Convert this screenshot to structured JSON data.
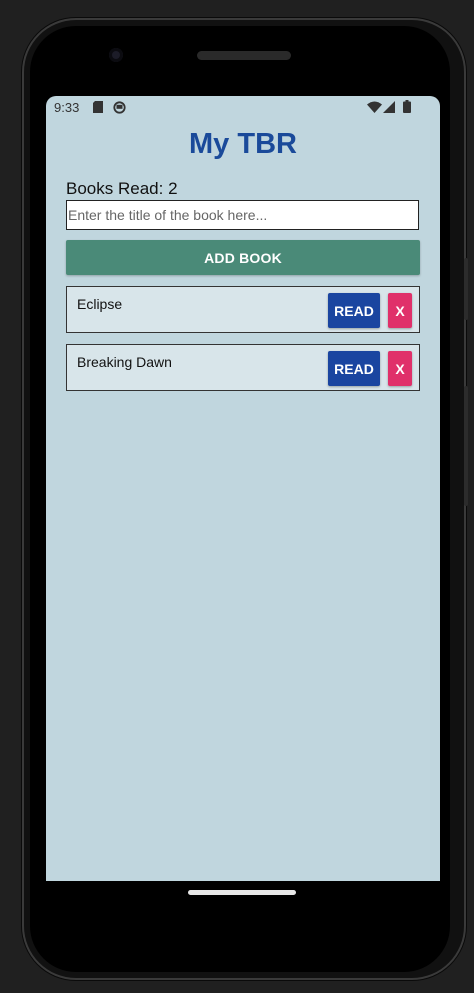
{
  "status_bar": {
    "time": "9:33",
    "icons": [
      "sd-card-icon",
      "notification-icon",
      "wifi-icon",
      "signal-icon",
      "battery-icon"
    ]
  },
  "app": {
    "title": "My TBR",
    "books_read_label": "Books Read: ",
    "books_read_count": "2",
    "input_placeholder": "Enter the title of the book here...",
    "input_value": "",
    "add_button_label": "ADD BOOK"
  },
  "books": [
    {
      "title": "Eclipse",
      "read_label": "READ",
      "remove_label": "X"
    },
    {
      "title": "Breaking Dawn",
      "read_label": "READ",
      "remove_label": "X"
    }
  ],
  "colors": {
    "background": "#c0d6de",
    "title": "#1a4a9a",
    "add_button": "#4a8a78",
    "read_button": "#1a45a0",
    "remove_button": "#e0306a",
    "card_background": "#d8e5ea"
  }
}
